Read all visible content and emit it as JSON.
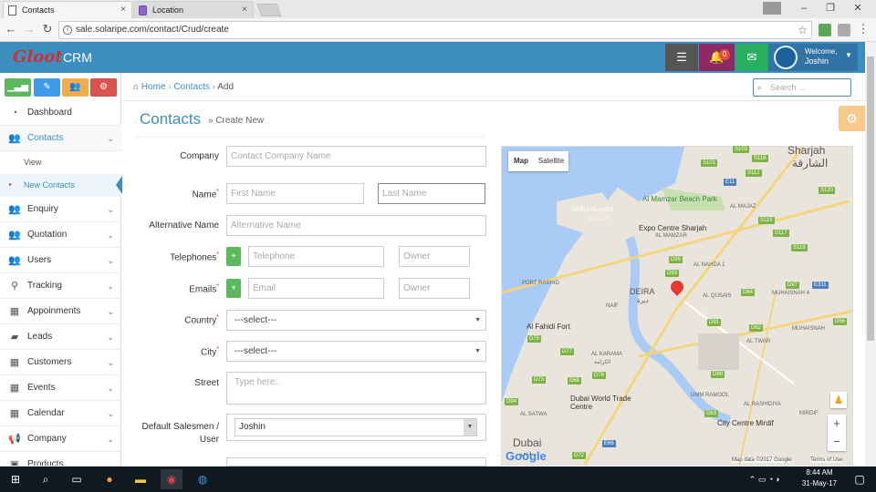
{
  "browser": {
    "tabs": [
      {
        "title": "Contacts",
        "active": true
      },
      {
        "title": "Location",
        "active": false
      }
    ],
    "url": "sale.solaripe.com/contact/Crud/create",
    "close_glyph": "×"
  },
  "header": {
    "brand": "CRM",
    "logo_text": "Gloot",
    "notification_count": "0",
    "welcome_label": "Welcome,",
    "username": "Joshin",
    "colors": {
      "bar": "#3d8dbf",
      "btn_dark": "#555555",
      "btn_notify": "#8e2a63",
      "btn_mail": "#27ae60"
    }
  },
  "quick_buttons": [
    {
      "icon": "signal-icon",
      "color": "#5cb85c"
    },
    {
      "icon": "pencil-icon",
      "color": "#3d9be9"
    },
    {
      "icon": "users-icon",
      "color": "#f0ad4e"
    },
    {
      "icon": "cogs-icon",
      "color": "#d9534f"
    }
  ],
  "sidebar": {
    "items": [
      {
        "label": "Dashboard",
        "icon": "dashboard-icon"
      },
      {
        "label": "Contacts",
        "icon": "users-icon",
        "active": true
      },
      {
        "label": "Enquiry",
        "icon": "users-icon"
      },
      {
        "label": "Quotation",
        "icon": "users-icon"
      },
      {
        "label": "Users",
        "icon": "users-icon"
      },
      {
        "label": "Tracking",
        "icon": "map-marker-icon"
      },
      {
        "label": "Appoinments",
        "icon": "calendar-icon"
      },
      {
        "label": "Leads",
        "icon": "folder-icon"
      },
      {
        "label": "Customers",
        "icon": "calendar-icon"
      },
      {
        "label": "Events",
        "icon": "calendar-icon"
      },
      {
        "label": "Calendar",
        "icon": "calendar-icon"
      },
      {
        "label": "Company",
        "icon": "bullhorn-icon"
      },
      {
        "label": "Products",
        "icon": "box-icon"
      }
    ],
    "contacts_sub": [
      {
        "label": "View"
      },
      {
        "label": "New Contacts",
        "active": true
      }
    ]
  },
  "breadcrumb": {
    "home": "Home",
    "section": "Contacts",
    "current": "Add"
  },
  "search": {
    "placeholder": "Search ..."
  },
  "page": {
    "title": "Contacts",
    "subtitle": "» Create New"
  },
  "form": {
    "company": {
      "label": "Company",
      "placeholder": "Contact Company Name"
    },
    "name": {
      "label": "Name",
      "first_placeholder": "First Name",
      "last_placeholder": "Last Name"
    },
    "alt_name": {
      "label": "Alternative Name",
      "placeholder": "Alternative Name"
    },
    "telephones": {
      "label": "Telephones",
      "placeholder": "Telephone",
      "owner_placeholder": "Owner"
    },
    "emails": {
      "label": "Emails",
      "placeholder": "Email",
      "owner_placeholder": "Owner"
    },
    "country": {
      "label": "Country",
      "value": "---select---"
    },
    "city": {
      "label": "City",
      "value": "---select---"
    },
    "street": {
      "label": "Street",
      "placeholder": "Type here.."
    },
    "salesmen": {
      "label": "Default Salesmen / User",
      "value": "Joshin"
    },
    "required_mark": "*",
    "add_glyph": "+"
  },
  "map": {
    "toggle": [
      "Map",
      "Satellite"
    ],
    "places": [
      "Sharjah",
      "الشارقة",
      "Al Mamzar Beach Park",
      "Expo Centre Sharjah",
      "AL MAMZAR",
      "AL MAJAZ",
      "DEIRA ISLANDS",
      "جزر ديرة",
      "AL NAHDA 1",
      "AL QUSAIS",
      "MUHAISNAH 4",
      "PORT RASHID",
      "NAIF",
      "DEIRA",
      "ديرة",
      "Al Fahidi Fort",
      "AL KARAMA",
      "الكرامة",
      "AL TWAR",
      "MUHAISNAH",
      "Dubai World Trade Centre",
      "UMM RAMOOL",
      "AL RASHIDIYA",
      "Dubai",
      "دبي",
      "AL SATWA",
      "City Centre Mirdif",
      "MIRDIF"
    ],
    "roads": [
      "S103",
      "S116",
      "S101",
      "S112",
      "E11",
      "S120",
      "S115",
      "S117",
      "S119",
      "D95",
      "D93",
      "E311",
      "D64",
      "D97",
      "D91",
      "D62",
      "D89",
      "D75",
      "D77",
      "D73",
      "D78",
      "D68",
      "D94",
      "D72",
      "E66",
      "D63",
      "D56"
    ],
    "footer": "Map data ©2017 Google",
    "terms": "Terms of Use",
    "google": "Google"
  },
  "taskbar": {
    "time": "8:44 AM",
    "date": "31-May-17"
  }
}
